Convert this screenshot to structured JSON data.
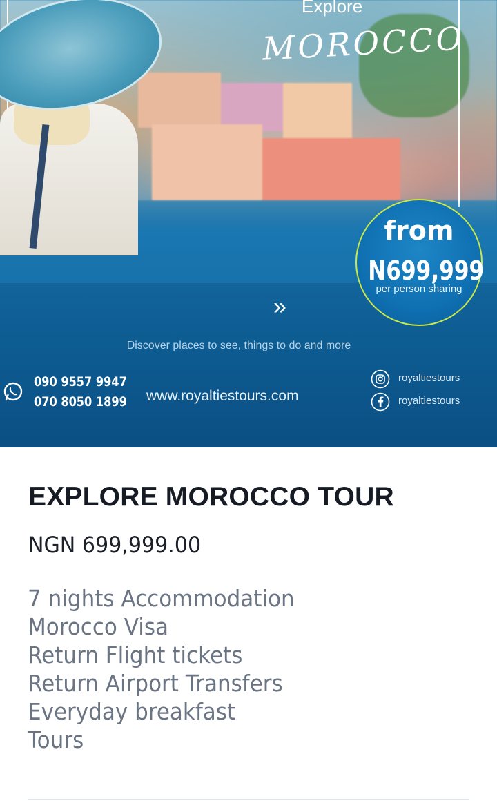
{
  "banner": {
    "explore_text": "Explore",
    "destination_text": "MOROCCO",
    "badge": {
      "from_label": "from",
      "price": "N699,999",
      "sub": "per person sharing"
    },
    "arrows": "»",
    "tagline": "Discover places to see, things to do and more",
    "phones": [
      "090  9557  9947",
      "070  8050  1899"
    ],
    "website": "www.royaltiestours.com",
    "social": [
      {
        "icon": "instagram-icon",
        "handle": "royaltiestours"
      },
      {
        "icon": "facebook-icon",
        "handle": "royaltiestours"
      }
    ],
    "colors": {
      "badge_ring": "#c9e84a",
      "banner_blue": "#0d5d93"
    }
  },
  "product": {
    "title": "EXPLORE MOROCCO TOUR",
    "price": "NGN 699,999.00",
    "features": [
      "7 nights Accommodation",
      "Morocco Visa",
      "Return Flight tickets",
      "Return Airport Transfers",
      "Everyday breakfast",
      "Tours"
    ]
  }
}
